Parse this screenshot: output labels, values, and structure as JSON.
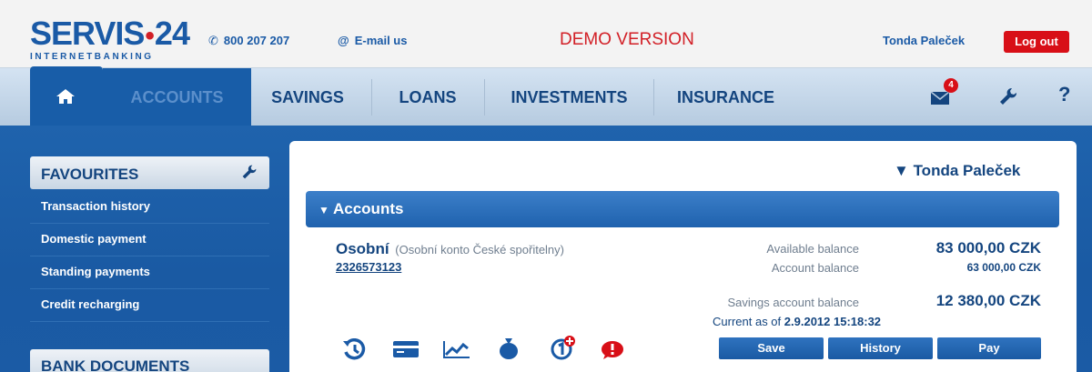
{
  "header": {
    "logo_main_left": "SERVIS",
    "logo_dot": "•",
    "logo_main_right": "24",
    "logo_sub": "INTERNETBANKING",
    "phone": "800 207 207",
    "email": "E-mail us",
    "demo": "DEMO VERSION",
    "user": "Tonda Paleček",
    "logout": "Log out"
  },
  "nav": {
    "items": [
      "ACCOUNTS",
      "SAVINGS",
      "LOANS",
      "INVESTMENTS",
      "INSURANCE"
    ],
    "messages_badge": "4",
    "help": "?"
  },
  "sidebar": {
    "favourites_title": "FAVOURITES",
    "items": [
      "Transaction history",
      "Domestic payment",
      "Standing payments",
      "Credit recharging"
    ],
    "bank_documents_title": "BANK DOCUMENTS"
  },
  "main": {
    "owner": "Tonda Paleček",
    "accounts_title": "Accounts",
    "account": {
      "name": "Osobní",
      "description": "(Osobní konto České spořitelny)",
      "number": "2326573123",
      "available_label": "Available balance",
      "available_value": "83 000,00 CZK",
      "balance_label": "Account balance",
      "balance_value": "63 000,00 CZK",
      "savings_label": "Savings account balance",
      "savings_value": "12 380,00 CZK",
      "asof_label": "Current as of",
      "asof_value": "2.9.2012 15:18:32"
    },
    "buttons": [
      "Save",
      "History",
      "Pay"
    ]
  },
  "colors": {
    "brand_blue": "#1a5aa6",
    "nav_active": "#185da8",
    "alert_red": "#d80f17"
  }
}
